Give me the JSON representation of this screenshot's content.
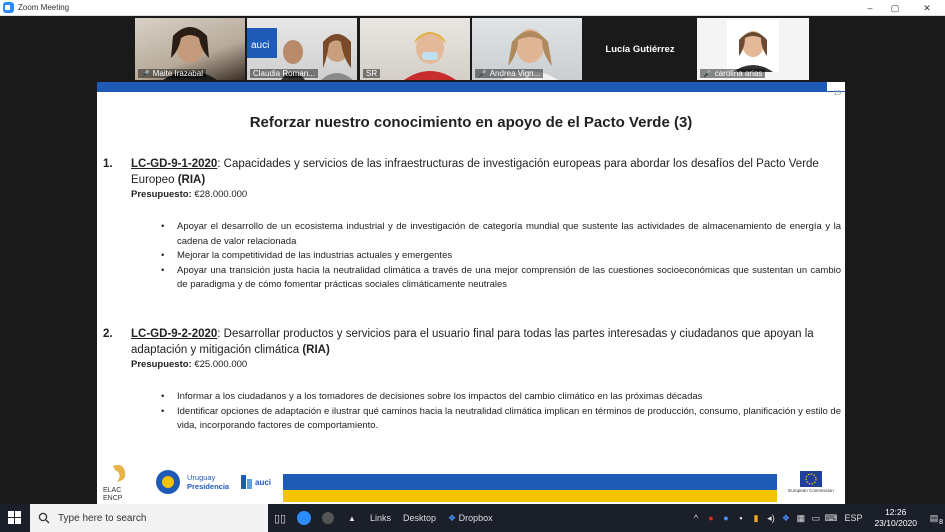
{
  "window": {
    "title": "Zoom Meeting",
    "min": "–",
    "max": "▢",
    "close": "✕"
  },
  "participants": [
    {
      "name": "Maite Irazabal"
    },
    {
      "name": "Claudia Roman..."
    },
    {
      "name": "SR"
    },
    {
      "name": "Andrea Vign..."
    },
    {
      "name": "Lucía Gutiérrez"
    },
    {
      "name": "carolina arias"
    }
  ],
  "slide": {
    "number": "15",
    "title": "Reforzar nuestro conocimiento en apoyo de el Pacto Verde (3)",
    "items": [
      {
        "num": "1.",
        "code": "LC-GD-9-1-2020",
        "desc": ": Capacidades y servicios de las infraestructuras de investigación europeas para abordar los desafíos del Pacto Verde Europeo ",
        "type": "(RIA)",
        "budget_label": "Presupuesto:",
        "budget_value": " €28.000.000",
        "bullets": [
          "Apoyar el desarrollo de un ecosistema industrial y de investigación de categoría mundial que sustente las actividades de almacenamiento de energía y la cadena de valor relacionada",
          "Mejorar la competitividad de las industrias actuales y emergentes",
          "Apoyar una transición justa hacia la neutralidad climática a través de una mejor comprensión de las cuestiones socioeconómicas que sustentan un cambio de paradigma y de cómo fomentar prácticas sociales climáticamente neutrales"
        ]
      },
      {
        "num": "2.",
        "code": "LC-GD-9-2-2020",
        "desc": ": Desarrollar productos y servicios para el usuario final para todas las partes interesadas y ciudadanos que apoyan la adaptación y mitigación climática ",
        "type": "(RIA)",
        "budget_label": "Presupuesto:",
        "budget_value": " €25.000.000",
        "bullets": [
          "Informar a los ciudadanos y a los tomadores de decisiones sobre los impactos del cambio climático en las próximas décadas",
          "Identificar opciones de adaptación e ilustrar qué caminos hacia la neutralidad climática implican en términos de producción, consumo, planificación y estilo de vida, incorporando factores de comportamiento."
        ]
      }
    ],
    "logos": {
      "elac": "ELAC\nENCP",
      "uruguay_1": "Uruguay",
      "uruguay_2": "Presidencia",
      "auci": "auci",
      "eu": "European Commission"
    }
  },
  "taskbar": {
    "search_placeholder": "Type here to search",
    "links": "Links",
    "desktop": "Desktop",
    "dropbox": "Dropbox",
    "lang": "ESP",
    "time": "12:26",
    "date": "23/10/2020",
    "notif_count": "8"
  }
}
